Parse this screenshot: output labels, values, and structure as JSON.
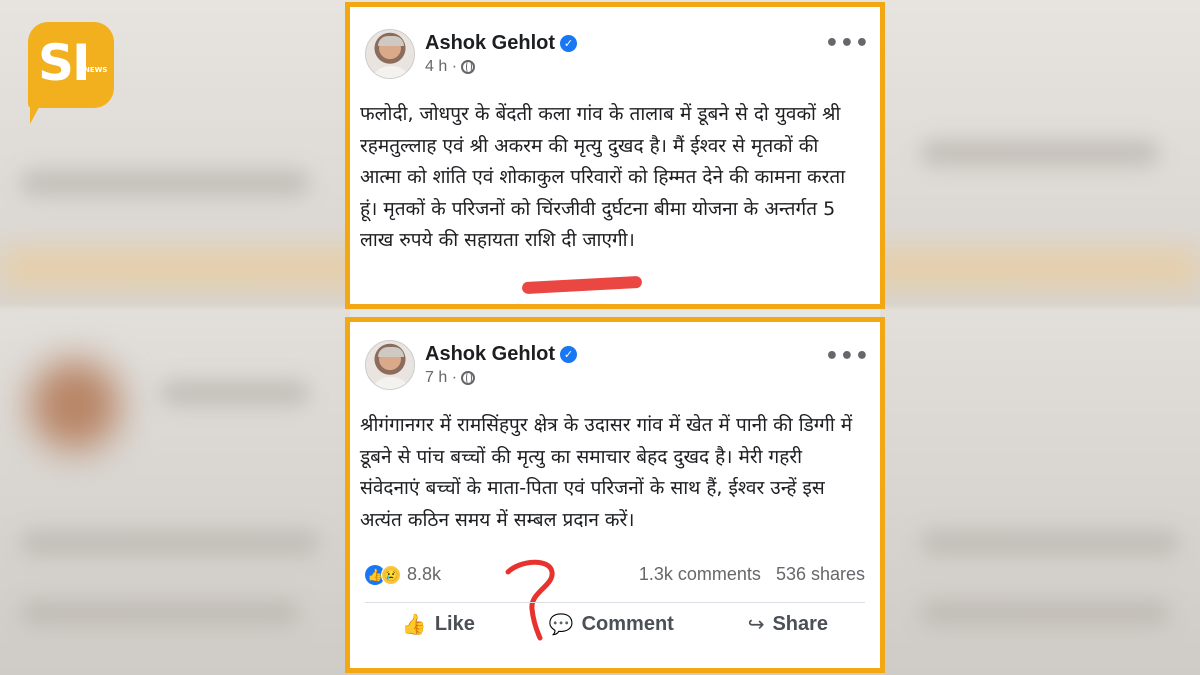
{
  "logo": {
    "letters": "SI",
    "sub": "NEWS"
  },
  "posts": [
    {
      "author": "Ashok Gehlot",
      "time": "4 h ·",
      "text": "फलोदी, जोधपुर के बेंदती कला गांव के तालाब में डूबने से दो युवकों श्री रहमतुल्लाह एवं श्री अकरम की मृत्यु दुखद है। मैं ईश्वर से मृतकों की आत्मा को शांति एवं शोकाकुल परिवारों को हिम्मत देने की कामना करता हूं। मृतकों के परिजनों को चिंरजीवी दुर्घटना बीमा योजना के अन्तर्गत 5 लाख रुपये की सहायता राशि दी जाएगी।"
    },
    {
      "author": "Ashok Gehlot",
      "time": "7 h ·",
      "text": "श्रीगंगानगर में रामसिंहपुर क्षेत्र के उदासर गांव में खेत में पानी की डिग्गी में डूबने से पांच बच्चों की मृत्यु का समाचार बेहद दुखद है। मेरी गहरी संवेदनाएं बच्चों के माता-पिता एवं परिजनों के साथ हैं, ईश्वर उन्हें इस अत्यंत कठिन समय में सम्बल प्रदान करें।",
      "reactions": "8.8k",
      "comments": "1.3k comments",
      "shares": "536 shares",
      "actions": {
        "like": "Like",
        "comment": "Comment",
        "share": "Share"
      }
    }
  ],
  "colors": {
    "frame": "#f3a712",
    "verified": "#1877f2",
    "highlight": "#e8322e",
    "logo": "#f2b01e"
  }
}
